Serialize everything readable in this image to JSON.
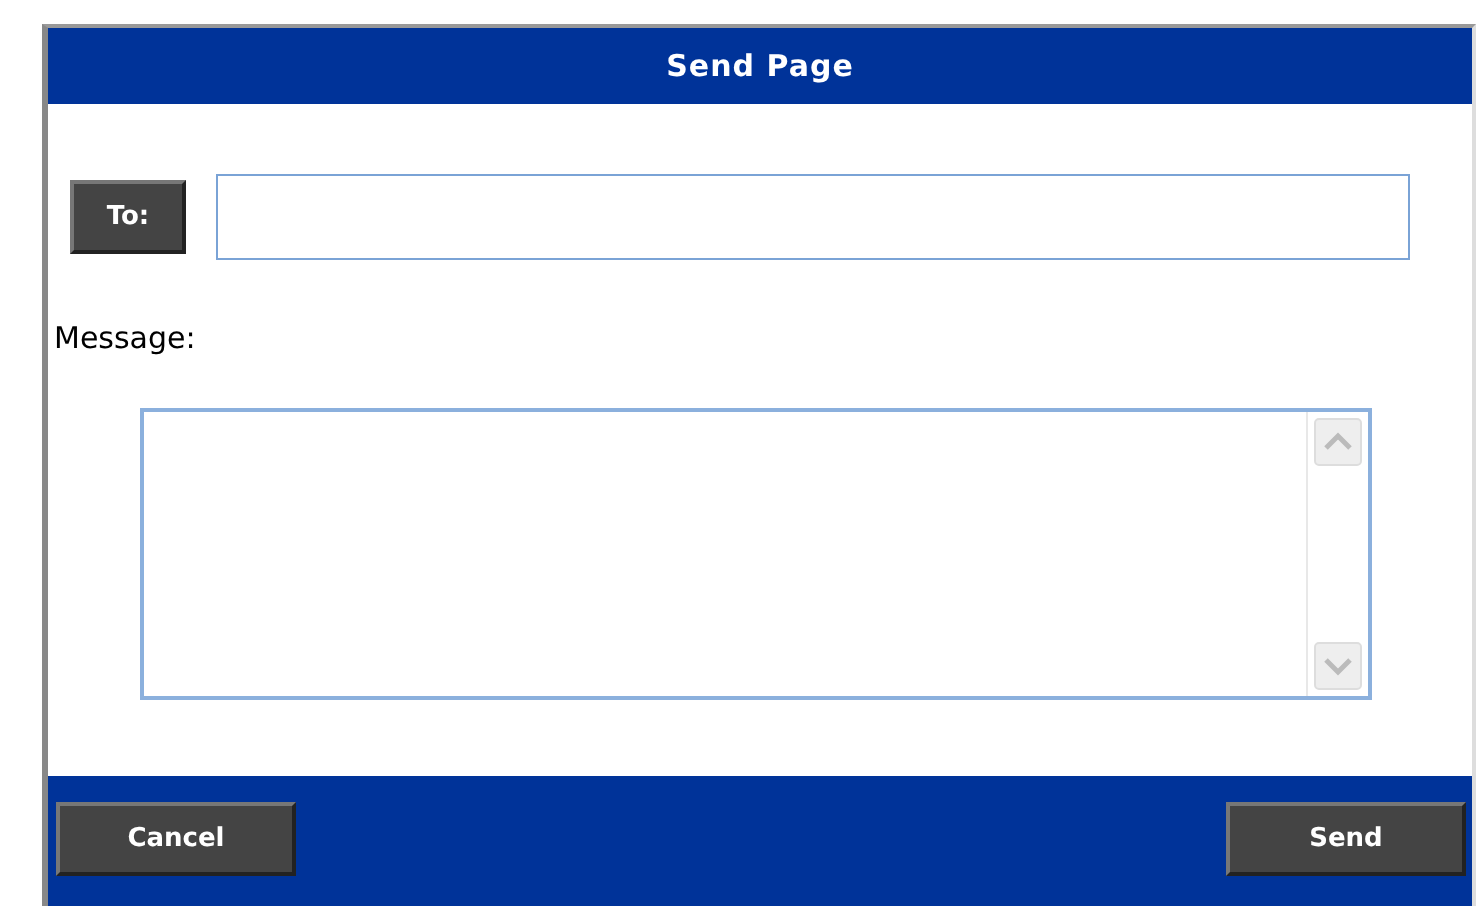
{
  "dialog": {
    "title": "Send Page",
    "to_button": "To:",
    "message_label": "Message:",
    "buttons": [
      {
        "label": "Cancel"
      },
      {
        "label": "Send"
      }
    ]
  }
}
